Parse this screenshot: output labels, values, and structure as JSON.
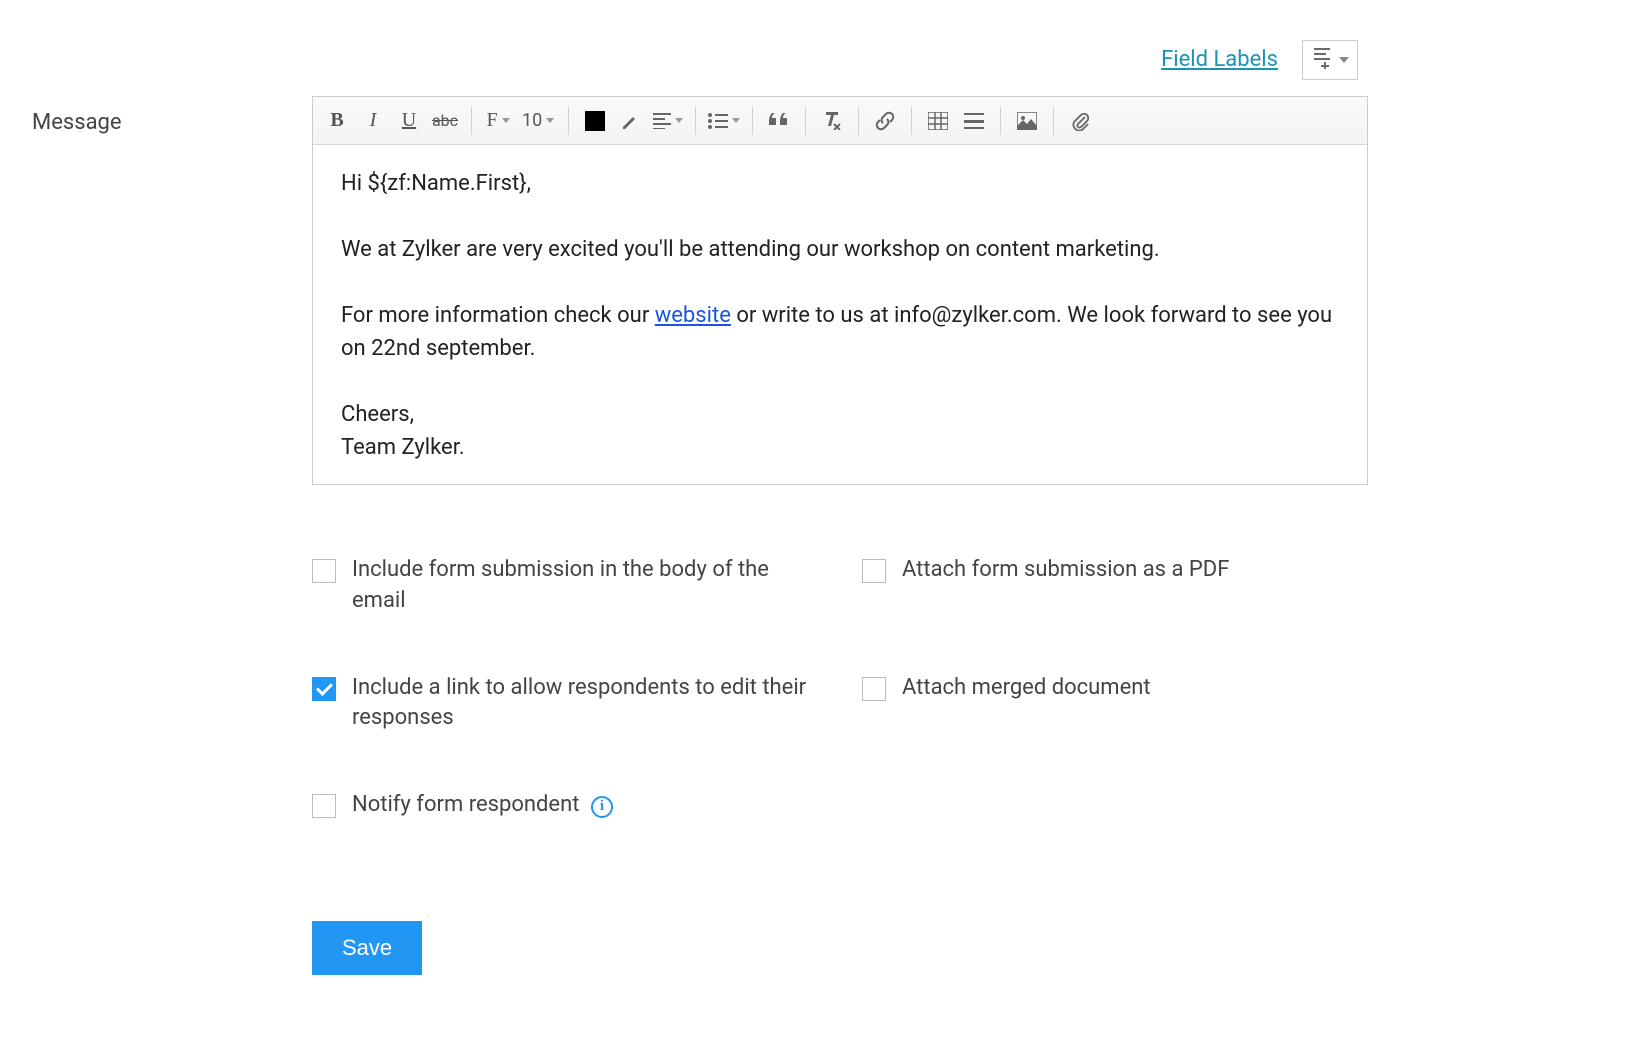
{
  "header": {
    "field_labels_link": "Field Labels"
  },
  "form": {
    "message_label": "Message"
  },
  "toolbar": {
    "font_size": "10"
  },
  "message": {
    "greeting": "Hi ${zf:Name.First},",
    "p1": "We at Zylker are very excited you'll be attending our workshop on content marketing.",
    "p2_before": "For more information check our ",
    "p2_link": "website",
    "p2_after": " or write to us at info@zylker.com. We look forward to see you on 22nd september.",
    "signoff1": "Cheers,",
    "signoff2": "Team Zylker."
  },
  "options": {
    "include_body": {
      "label": "Include form submission in the body of the email",
      "checked": false
    },
    "attach_pdf": {
      "label": "Attach form submission as a PDF",
      "checked": false
    },
    "edit_link": {
      "label": "Include a link to allow respondents to edit their responses",
      "checked": true
    },
    "attach_merged": {
      "label": "Attach merged document",
      "checked": false
    },
    "notify": {
      "label": "Notify form respondent",
      "checked": false
    }
  },
  "buttons": {
    "save": "Save"
  }
}
